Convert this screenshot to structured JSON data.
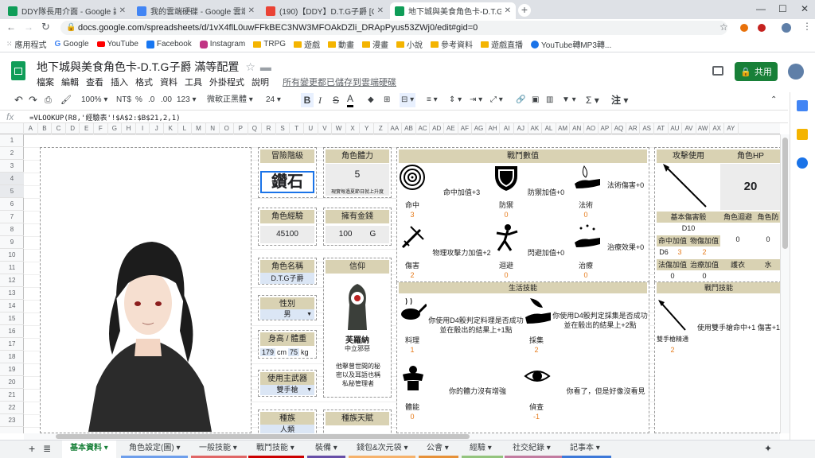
{
  "browser": {
    "tabs": [
      {
        "title": "DDY隊長用介面 - Google 試算表",
        "color": "#0f9d58"
      },
      {
        "title": "我的雲端硬碟 - Google 雲端硬碟",
        "color": "#4285f4"
      },
      {
        "title": "(190)【DDY】D.T.G子爵 [Code",
        "color": "#ea4335"
      },
      {
        "title": "地下城與美食角色卡-D.T.G子爵 - ",
        "color": "#0f9d58"
      }
    ],
    "url": "docs.google.com/spreadsheets/d/1vX4flL0uwFFkBEC3NW3MFOAkDZli_DRApPyus53ZWj0/edit#gid=0",
    "bookmarks": [
      "應用程式",
      "Google",
      "YouTube",
      "Facebook",
      "Instagram",
      "TRPG",
      "遊戲",
      "動畫",
      "漫畫",
      "小說",
      "參考資料",
      "遊戲直播",
      "YouTube轉MP3轉..."
    ]
  },
  "sheet": {
    "title": "地下城與美食角色卡-D.T.G子爵 滿等配置",
    "menus": [
      "檔案",
      "編輯",
      "查看",
      "插入",
      "格式",
      "資料",
      "工具",
      "外掛程式",
      "說明"
    ],
    "saved_note": "所有變更都已儲存到雲端硬碟",
    "share_label": "共用",
    "toolbar": {
      "zoom": "100%",
      "currency": "NT$",
      "percent": "%",
      "dec_down": ".0",
      "dec_up": ".00",
      "format": "123",
      "font": "微軟正黑體",
      "font_size": "24"
    },
    "formula": "=VLOOKUP(R8,'經驗表'!$A$2:$B$21,2,1)",
    "columns": [
      "A",
      "B",
      "C",
      "D",
      "E",
      "F",
      "G",
      "H",
      "I",
      "J",
      "K",
      "L",
      "M",
      "N",
      "O",
      "P",
      "Q",
      "R",
      "S",
      "T",
      "U",
      "V",
      "W",
      "X",
      "Y",
      "Z",
      "AA",
      "AB",
      "AC",
      "AD",
      "AE",
      "AF",
      "AG",
      "AH",
      "AI",
      "AJ",
      "AK",
      "AL",
      "AM",
      "AN",
      "AO",
      "AP",
      "AQ",
      "AR",
      "AS",
      "AT",
      "AU",
      "AV",
      "AW",
      "AX",
      "AY"
    ],
    "rows": [
      "1",
      "2",
      "3",
      "4",
      "5",
      "6",
      "7",
      "8",
      "9",
      "10",
      "11",
      "12",
      "13",
      "14",
      "15",
      "16",
      "17",
      "18",
      "19",
      "20",
      "21",
      "22",
      "23"
    ],
    "sheet_tabs": [
      "基本資料",
      "角色設定(圖)",
      "一般技能",
      "戰鬥技能",
      "裝備",
      "錢包&次元袋",
      "公會",
      "經驗",
      "社交紀錄",
      "記事本"
    ]
  },
  "card": {
    "rank_label": "冒險階級",
    "rank_value": "鑽石",
    "stamina_label": "角色體力",
    "stamina_value": "5",
    "stamina_note": "現實每過夏節日就上升度",
    "exp_label": "角色經驗",
    "exp_value": "45100",
    "gold_label": "擁有金錢",
    "gold_value": "100",
    "gold_unit": "G",
    "name_label": "角色名稱",
    "name_value": "D.T.G子爵",
    "faith_label": "信仰",
    "faith_god": "芙羅納",
    "faith_align": "中立邪惡",
    "faith_desc": "他擊曾世間的秘密以及耳語也稱私秘管理者",
    "gender_label": "性別",
    "gender_value": "男",
    "hw_label": "身高 / 體重",
    "height": "179",
    "height_unit": "cm",
    "weight": "75",
    "weight_unit": "kg",
    "weapon_label": "使用主武器",
    "weapon_value": "雙手槍",
    "race_label": "種族",
    "race_value": "人類",
    "race_talent_label": "種族天賦",
    "battle": {
      "title": "戰鬥數值",
      "cells": [
        {
          "name": "命中",
          "value": "3",
          "desc": "命中加值+3"
        },
        {
          "name": "防禦",
          "value": "0",
          "desc": "防禦加值+0"
        },
        {
          "name": "法術",
          "value": "0",
          "desc": "法術傷害+0"
        },
        {
          "name": "傷害",
          "value": "2",
          "desc": "物理攻擊力加值+2"
        },
        {
          "name": "迴避",
          "value": "0",
          "desc": "閃避加值+0"
        },
        {
          "name": "治療",
          "value": "0",
          "desc": "治療效果+0"
        }
      ]
    },
    "life": {
      "title": "生活技能",
      "cells": [
        {
          "name": "料理",
          "value": "1",
          "desc": "你使用D4骰判定料理是否成功並在骰出的結果上+1點"
        },
        {
          "name": "採集",
          "value": "2",
          "desc": "你使用D4骰判定採集是否成功並在骰出的結果上+2點"
        },
        {
          "name": "體能",
          "value": "0",
          "desc": "你的體力沒有增強"
        },
        {
          "name": "偵查",
          "value": "-1",
          "desc": "你看了，但是好像沒看見"
        }
      ]
    },
    "attack": {
      "title": "攻擊使用",
      "hp_label": "角色HP",
      "hp_value": "20",
      "base_dmg_label": "基本傷害骰",
      "base_dmg": "D10",
      "dodge_label": "角色迴避",
      "dodge_value": "0",
      "def_label": "角色防",
      "def_value": "0",
      "hit_bonus_label": "命中加值",
      "phys_bonus_label": "物傷加值",
      "d6": "D6",
      "hit_bonus": "3",
      "phys_bonus": "2",
      "spell_bonus_label": "法傷加值",
      "heal_bonus_label": "治療加值",
      "armor_label": "護衣",
      "water_label": "水",
      "spell_bonus": "0",
      "heal_bonus": "0",
      "skill_title": "戰鬥技能",
      "skill_name": "雙手槍精通",
      "skill_value": "2",
      "skill_desc": "使用雙手槍命中+1 傷害+1"
    }
  }
}
